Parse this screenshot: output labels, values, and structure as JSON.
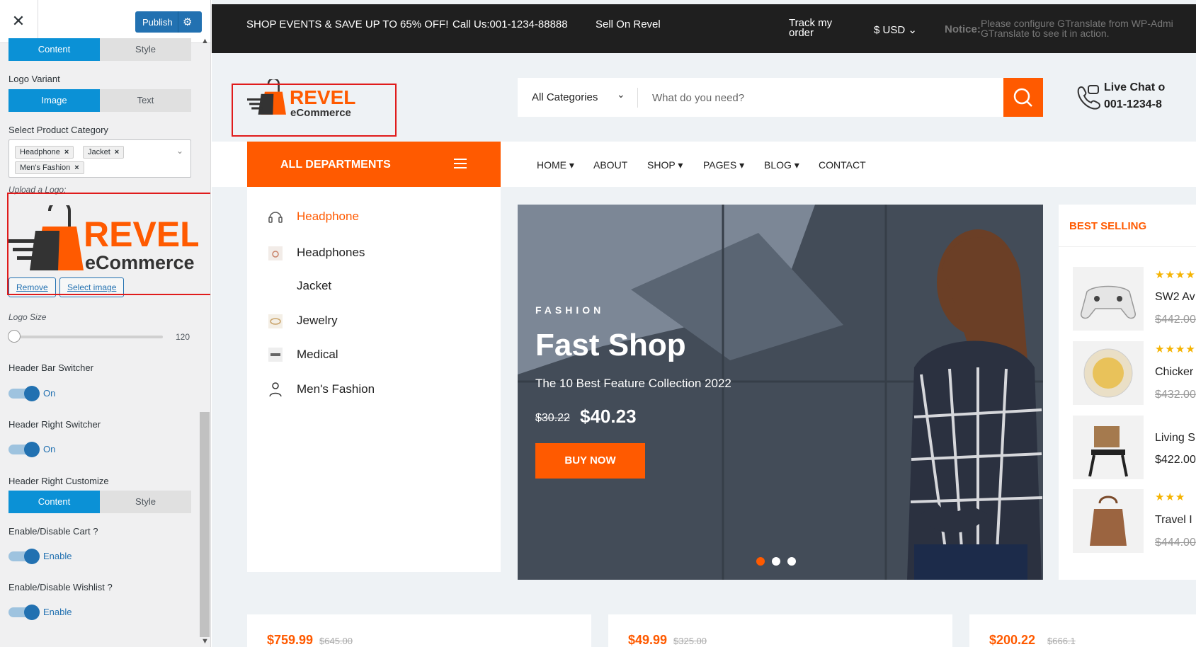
{
  "customizer": {
    "publish_label": "Publish",
    "logo_section_tabs": [
      "Content",
      "Style"
    ],
    "logo_variant_label": "Logo Variant",
    "logo_variant_options": [
      "Image",
      "Text"
    ],
    "category_label": "Select Product Category",
    "category_tags": [
      "Headphone",
      "Jacket",
      "Men's Fashion"
    ],
    "upload_logo_label": "Upload a Logo:",
    "logo_brand": "REVEL",
    "logo_sub": "eCommerce",
    "remove_label": "Remove",
    "select_image_label": "Select image",
    "logo_size_label": "Logo Size",
    "logo_size_value": "120",
    "header_bar_label": "Header Bar Switcher",
    "header_bar_state": "On",
    "header_right_label": "Header Right Switcher",
    "header_right_state": "On",
    "header_right_customize_label": "Header Right Customize",
    "header_right_tabs": [
      "Content",
      "Style"
    ],
    "cart_label": "Enable/Disable Cart ?",
    "cart_state": "Enable",
    "wishlist_label": "Enable/Disable Wishlist ?",
    "wishlist_state": "Enable"
  },
  "topbar": {
    "promo": "SHOP EVENTS & SAVE UP TO 65% OFF!",
    "call": "Call Us:001-1234-88888",
    "sell": "Sell On Revel",
    "track_line1": "Track my",
    "track_line2": "order",
    "currency": "$ USD",
    "notice_label": "Notice:",
    "notice_line1": "Please configure GTranslate from WP-Admi",
    "notice_line2": "GTranslate to see it in action."
  },
  "header": {
    "logo_brand": "REVEL",
    "logo_sub": "eCommerce",
    "search_category": "All Categories",
    "search_placeholder": "What do you need?",
    "livechat_line1": "Live Chat o",
    "livechat_line2": "001-1234-8"
  },
  "nav": {
    "all_departments": "ALL DEPARTMENTS",
    "links": [
      "HOME",
      "ABOUT",
      "SHOP",
      "PAGES",
      "BLOG",
      "CONTACT"
    ]
  },
  "departments": [
    "Headphone",
    "Headphones",
    "Jacket",
    "Jewelry",
    "Medical",
    "Men's Fashion"
  ],
  "hero": {
    "kicker": "FASHION",
    "title": "Fast Shop",
    "subtitle": "The 10 Best Feature Collection 2022",
    "old_price": "$30.22",
    "new_price": "$40.23",
    "cta": "BUY NOW"
  },
  "best_selling": {
    "title": "BEST SELLING",
    "items": [
      {
        "name": "SW2 Av",
        "price": "$442.00",
        "stars": "★★★★"
      },
      {
        "name": "Chicker",
        "price": "$432.00",
        "stars": "★★★★"
      },
      {
        "name": "Living S",
        "price": "$422.00",
        "stars": ""
      },
      {
        "name": "Travel I",
        "price": "$444.00",
        "stars": "★★★"
      }
    ]
  },
  "products": [
    {
      "price": "$759.99",
      "old": "$645.00"
    },
    {
      "price": "$49.99",
      "old": "$325.00"
    },
    {
      "price": "$200.22",
      "old": "$666.1"
    }
  ],
  "colors": {
    "accent": "#ff5a00",
    "wp_blue": "#2271b1",
    "seg_blue": "#0b91d6",
    "topbar": "#1f1f1f"
  }
}
